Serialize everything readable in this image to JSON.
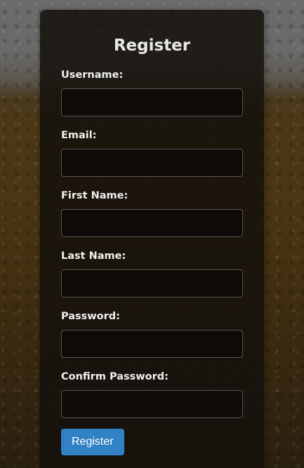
{
  "form": {
    "title": "Register",
    "fields": [
      {
        "label": "Username:",
        "value": ""
      },
      {
        "label": "Email:",
        "value": ""
      },
      {
        "label": "First Name:",
        "value": ""
      },
      {
        "label": "Last Name:",
        "value": ""
      },
      {
        "label": "Password:",
        "value": ""
      },
      {
        "label": "Confirm Password:",
        "value": ""
      }
    ],
    "submit_label": "Register"
  },
  "colors": {
    "accent": "#3182c4",
    "card_background": "#14100c",
    "input_border": "#5a5550"
  }
}
